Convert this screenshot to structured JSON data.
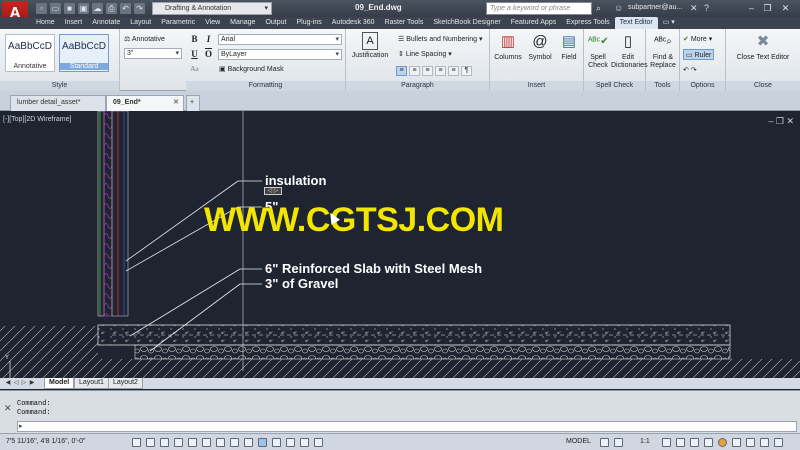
{
  "app": {
    "logo_letter": "A",
    "workspace": "Drafting & Annotation",
    "doc_title": "09_End.dwg",
    "search_placeholder": "Type a keyword or phrase",
    "username": "subpartner@au..."
  },
  "ribbon_tabs": [
    "Home",
    "Insert",
    "Annotate",
    "Layout",
    "Parametric",
    "View",
    "Manage",
    "Output",
    "Plug-ins",
    "Autodesk 360",
    "Raster Tools",
    "SketchBook Designer",
    "Featured Apps",
    "Express Tools",
    "Text Editor"
  ],
  "ribbon_active_tab": "Text Editor",
  "panels": {
    "style": {
      "title": "Style",
      "swatch_sample": "AaBbCcD",
      "swatch1_label": "Annotative",
      "swatch2_label": "Standard",
      "annotative_label": "Annotative",
      "height_value": "3\""
    },
    "formatting": {
      "title": "Formatting",
      "bold": "B",
      "italic": "I",
      "underline": "U",
      "overline": "O",
      "font_value": "Arial",
      "color_value": "ByLayer",
      "bg_mask_label": "Background Mask"
    },
    "paragraph": {
      "title": "Paragraph",
      "justification_label": "Justification",
      "bullets_label": "Bullets and Numbering",
      "line_spacing_label": "Line Spacing"
    },
    "insert": {
      "title": "Insert",
      "columns_label": "Columns",
      "symbol_label": "Symbol",
      "field_label": "Field"
    },
    "spell": {
      "title": "Spell Check",
      "spell_label": "Spell Check",
      "edit_dict_label": "Edit Dictionaries"
    },
    "tools": {
      "title": "Tools",
      "find_label": "Find & Replace"
    },
    "options": {
      "title": "Options",
      "more_label": "More",
      "ruler_label": "Ruler"
    },
    "close": {
      "title": "Close",
      "close_label": "Close Text Editor"
    }
  },
  "file_tabs": [
    {
      "label": "lumber detail_asset*"
    },
    {
      "label": "09_End*"
    }
  ],
  "viewport_label": "[-][Top][2D Wireframe]",
  "drawing": {
    "label_insulation": "insulation",
    "label_5": "5\"",
    "label_slab": "6\" Reinforced Slab  with Steel Mesh",
    "label_gravel": "3\" of Gravel",
    "watermark": "WWW.CGTSJ.COM"
  },
  "layout_tabs": [
    "Model",
    "Layout1",
    "Layout2"
  ],
  "command": {
    "line1": "Command:",
    "line2": "Command:",
    "input_placeholder": ""
  },
  "status": {
    "coords": "7'5 11/16\", 4'8 1/16\", 0'-0\"",
    "model": "MODEL",
    "scale": "1:1"
  }
}
